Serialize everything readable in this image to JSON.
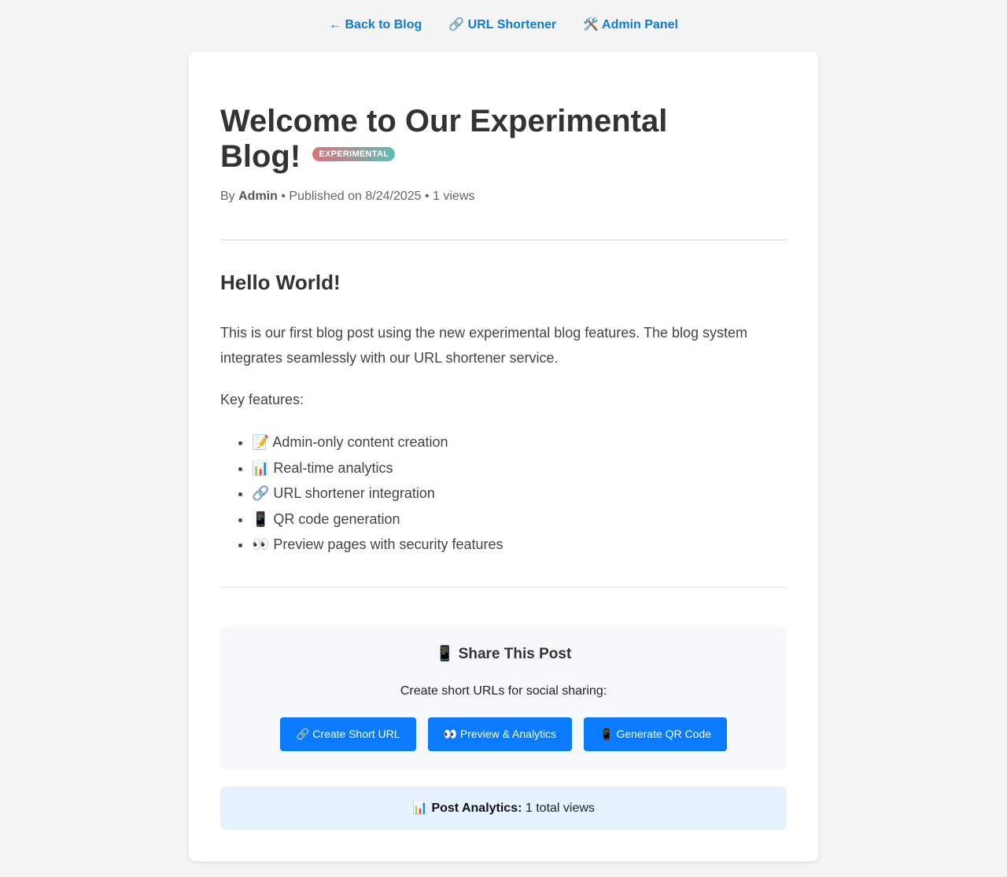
{
  "nav": {
    "back_label": "← Back to Blog",
    "shortener_label": "🔗 URL Shortener",
    "admin_label": "🛠️ Admin Panel"
  },
  "post": {
    "title": "Welcome to Our Experimental Blog!",
    "badge": "EXPERIMENTAL",
    "meta": {
      "by_prefix": "By ",
      "author": "Admin",
      "published_text": " • Published on 8/24/2025 • 1 views"
    },
    "heading": "Hello World!",
    "paragraph": "This is our first blog post using the new experimental blog features. The blog system integrates seamlessly with our URL shortener service.",
    "features_intro": "Key features:",
    "features": [
      "📝 Admin-only content creation",
      "📊 Real-time analytics",
      "🔗 URL shortener integration",
      "📱 QR code generation",
      "👀 Preview pages with security features"
    ]
  },
  "share": {
    "title": "📱 Share This Post",
    "subtitle": "Create short URLs for social sharing:",
    "buttons": {
      "short_url": "🔗 Create Short URL",
      "preview": "👀 Preview & Analytics",
      "qr": "📱 Generate QR Code"
    }
  },
  "analytics": {
    "icon": "📊",
    "label": "Post Analytics:",
    "value": " 1 total views"
  },
  "colors": {
    "link": "#0a7be0",
    "button": "#0a7bff",
    "badge_gradient_start": "#e0707a",
    "badge_gradient_end": "#5bbfb6",
    "analytics_bg": "#e6f2fd"
  }
}
